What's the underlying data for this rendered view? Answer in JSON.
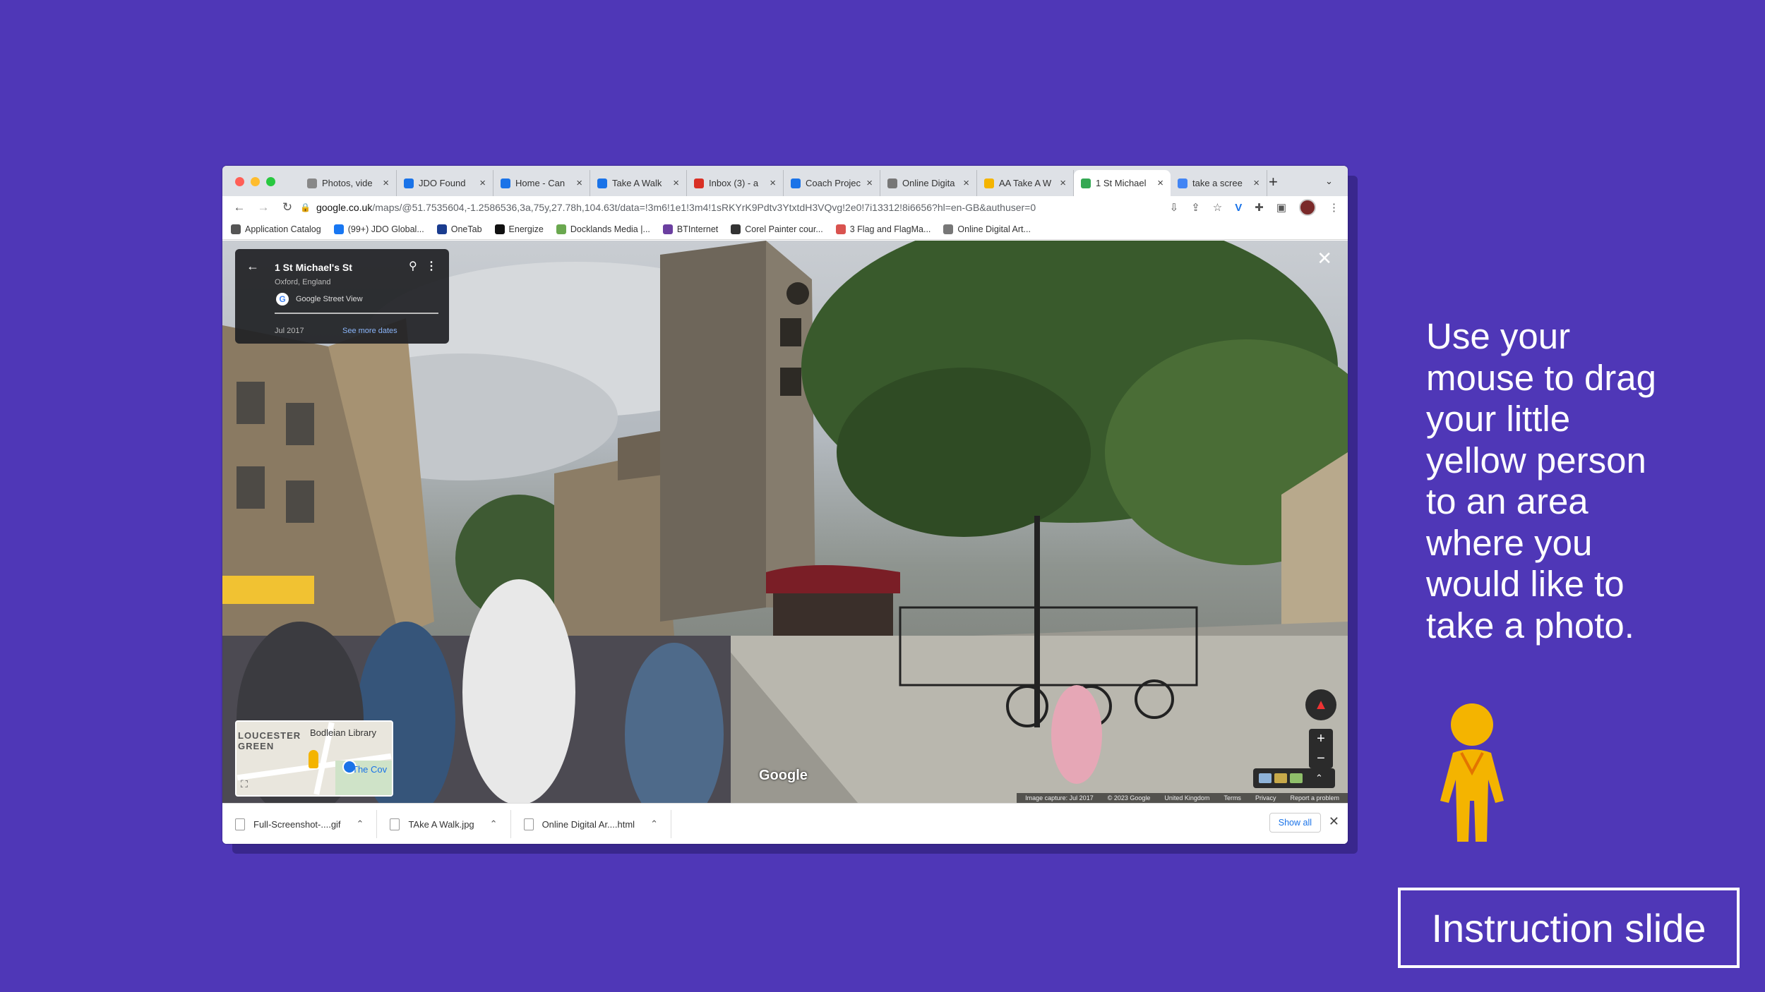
{
  "browser": {
    "tabs": [
      {
        "label": "Photos, vide",
        "favicon": "photos-icon",
        "color": "#888888"
      },
      {
        "label": "JDO Found",
        "favicon": "jdo-icon",
        "color": "#1a73e8"
      },
      {
        "label": "Home - Can",
        "favicon": "canva-icon",
        "color": "#1a73e8"
      },
      {
        "label": "Take A Walk",
        "favicon": "canva-icon",
        "color": "#1a73e8"
      },
      {
        "label": "Inbox (3) - a",
        "favicon": "gmail-icon",
        "color": "#d93025"
      },
      {
        "label": "Coach Projec",
        "favicon": "docs-icon",
        "color": "#1a73e8"
      },
      {
        "label": "Online Digita",
        "favicon": "lock-icon",
        "color": "#777777"
      },
      {
        "label": "AA Take A W",
        "favicon": "slides-icon",
        "color": "#f4b400"
      },
      {
        "label": "1 St Michael",
        "favicon": "maps-icon",
        "color": "#34a853",
        "active": true
      },
      {
        "label": "take a scree",
        "favicon": "google-icon",
        "color": "#4285f4"
      }
    ],
    "url_host": "google.co.uk",
    "url_rest": "/maps/@51.7535604,-1.2586536,3a,75y,27.78h,104.63t/data=!3m6!1e1!3m4!1sRKYrK9Pdtv3YtxtdH3VQvg!2e0!7i13312!8i6656?hl=en-GB&authuser=0",
    "bookmarks": [
      {
        "label": "Application Catalog",
        "color": "#555555"
      },
      {
        "label": "(99+) JDO Global...",
        "color": "#1877f2"
      },
      {
        "label": "OneTab",
        "color": "#1a3c8f"
      },
      {
        "label": "Energize",
        "color": "#111111"
      },
      {
        "label": "Docklands Media |...",
        "color": "#6aa84f"
      },
      {
        "label": "BTInternet",
        "color": "#6b3fa0"
      },
      {
        "label": "Corel Painter cour...",
        "color": "#333333"
      },
      {
        "label": "3 Flag and FlagMa...",
        "color": "#d9534f"
      },
      {
        "label": "Online Digital Art...",
        "color": "#777777"
      }
    ]
  },
  "streetview": {
    "title": "1 St Michael's St",
    "subtitle": "Oxford, England",
    "source": "Google Street View",
    "date": "Jul 2017",
    "more_dates": "See more dates",
    "minimap": {
      "area_label": "LOUCESTER GREEN",
      "library": "Bodleian Library",
      "pin_label": "The Cov"
    },
    "watermark": "Google",
    "footer": [
      "Image capture: Jul 2017",
      "© 2023 Google",
      "United Kingdom",
      "Terms",
      "Privacy",
      "Report a problem"
    ]
  },
  "downloads": {
    "items": [
      "Full-Screenshot-....gif",
      "TAke A Walk.jpg",
      "Online Digital Ar....html"
    ],
    "show_all": "Show all"
  },
  "instruction": {
    "text": "Use your mouse to drag your little yellow person to an area where you would like to take a photo.",
    "slide_label": "Instruction slide"
  },
  "colors": {
    "background": "#4f37b7",
    "pegman": "#f4b400"
  }
}
